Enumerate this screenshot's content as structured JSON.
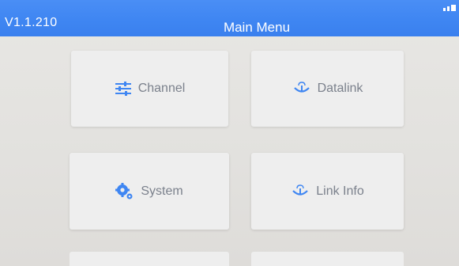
{
  "header": {
    "version": "V1.1.210",
    "title": "Main Menu"
  },
  "menu": {
    "items": [
      {
        "label": "Channel",
        "icon": "sliders-icon"
      },
      {
        "label": "Datalink",
        "icon": "antenna-signal-icon"
      },
      {
        "label": "System",
        "icon": "gears-icon"
      },
      {
        "label": "Link Info",
        "icon": "antenna-signal-icon"
      }
    ]
  },
  "colors": {
    "title_bar": "#3f86f2",
    "icon_accent": "#3f86f2",
    "tile_text": "#7b818c"
  }
}
